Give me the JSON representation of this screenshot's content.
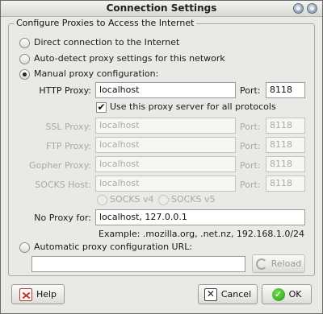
{
  "window": {
    "title": "Connection Settings"
  },
  "group": {
    "legend": "Configure Proxies to Access the Internet"
  },
  "options": {
    "direct": "Direct connection to the Internet",
    "auto_detect": "Auto-detect proxy settings for this network",
    "manual": "Manual proxy configuration:",
    "auto_url": "Automatic proxy configuration URL:"
  },
  "manual": {
    "http": {
      "label": "HTTP Proxy:",
      "value": "localhost",
      "port_label": "Port:",
      "port": "8118"
    },
    "use_same": {
      "label": "Use this proxy server for all protocols",
      "checked": "✔"
    },
    "ssl": {
      "label": "SSL Proxy:",
      "value": "localhost",
      "port_label": "Port:",
      "port": "8118"
    },
    "ftp": {
      "label": "FTP Proxy:",
      "value": "localhost",
      "port_label": "Port:",
      "port": "8118"
    },
    "gopher": {
      "label": "Gopher Proxy:",
      "value": "localhost",
      "port_label": "Port:",
      "port": "8118"
    },
    "socks": {
      "label": "SOCKS Host:",
      "value": "localhost",
      "port_label": "Port:",
      "port": "8118"
    },
    "socks_v4": "SOCKS v4",
    "socks_v5": "SOCKS v5",
    "no_proxy": {
      "label": "No Proxy for:",
      "value": "localhost, 127.0.0.1"
    },
    "example": "Example: .mozilla.org, .net.nz, 192.168.1.0/24"
  },
  "auto_url": {
    "value": "",
    "reload_label": "Reload"
  },
  "buttons": {
    "help": "Help",
    "cancel": "Cancel",
    "ok": "OK"
  },
  "icons": {
    "help": "help-icon",
    "cancel": "cancel-icon",
    "ok": "ok-icon",
    "reload": "reload-icon"
  }
}
